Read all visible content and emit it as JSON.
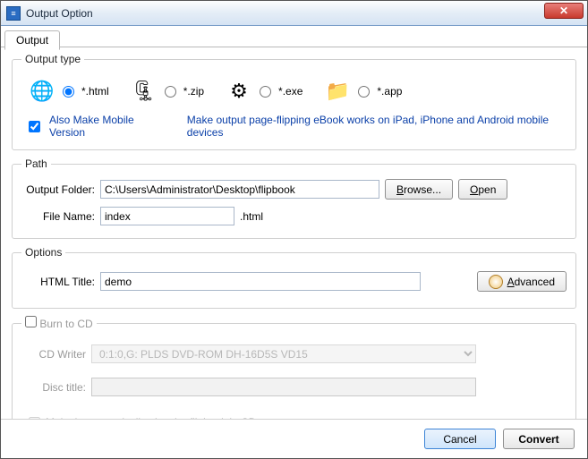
{
  "window": {
    "title": "Output Option",
    "close_glyph": "✕"
  },
  "tabs": {
    "output": "Output"
  },
  "outputType": {
    "legend": "Output type",
    "options": {
      "html": {
        "label": "*.html",
        "icon": "🌐"
      },
      "zip": {
        "label": "*.zip",
        "icon": "🗜"
      },
      "exe": {
        "label": "*.exe",
        "icon": "⚙"
      },
      "app": {
        "label": "*.app",
        "icon": "📁"
      }
    },
    "selected": "html",
    "alsoMobile": {
      "label": "Also Make Mobile Version",
      "checked": true
    },
    "mobileHint": "Make output page-flipping eBook works on iPad, iPhone and Android mobile devices"
  },
  "path": {
    "legend": "Path",
    "outputFolderLabel": "Output Folder:",
    "outputFolderValue": "C:\\Users\\Administrator\\Desktop\\flipbook",
    "browseU": "B",
    "browseRest": "rowse...",
    "openU": "O",
    "openRest": "pen",
    "fileNameLabel": "File Name:",
    "fileNameValue": "index",
    "fileExt": ".html"
  },
  "options": {
    "legend": "Options",
    "htmlTitleLabel": "HTML Title:",
    "htmlTitleValue": "demo",
    "advancedU": "A",
    "advancedRest": "dvanced"
  },
  "burn": {
    "legendU": "B",
    "legendRest": "urn to CD",
    "checked": false,
    "cdWriterLabel": "CD Writer",
    "cdWriterValue": "0:1:0,G: PLDS    DVD-ROM DH-16D5S VD15",
    "discTitleLabel": "Disc title:",
    "discTitleValue": "",
    "autoplayLabel": "Make it automatically play the flipbook in CD",
    "autoplayChecked": false
  },
  "footer": {
    "cancel": "Cancel",
    "convert": "Convert"
  }
}
